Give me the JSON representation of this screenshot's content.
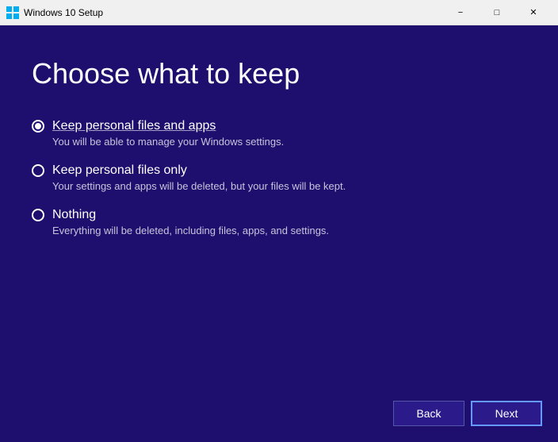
{
  "titlebar": {
    "title": "Windows 10 Setup",
    "minimize_label": "−",
    "maximize_label": "□",
    "close_label": "✕"
  },
  "page": {
    "heading": "Choose what to keep"
  },
  "options": [
    {
      "id": "keep-files-apps",
      "label": "Keep personal files and apps",
      "description": "You will be able to manage your Windows settings.",
      "selected": true
    },
    {
      "id": "keep-files-only",
      "label": "Keep personal files only",
      "description": "Your settings and apps will be deleted, but your files will be kept.",
      "selected": false
    },
    {
      "id": "nothing",
      "label": "Nothing",
      "description": "Everything will be deleted, including files, apps, and settings.",
      "selected": false
    }
  ],
  "footer": {
    "back_label": "Back",
    "next_label": "Next"
  }
}
